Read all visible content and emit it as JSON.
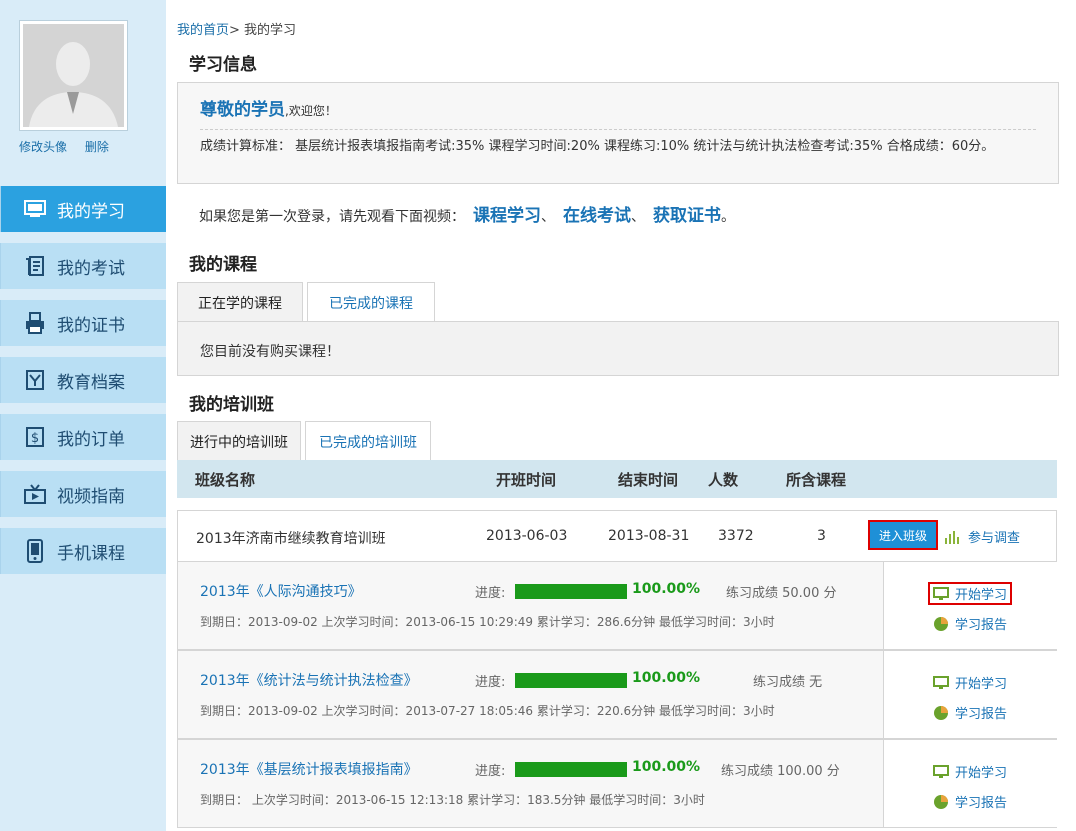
{
  "sidebar": {
    "change_avatar": "修改头像",
    "delete": "删除",
    "items": [
      {
        "label": "我的学习",
        "icon": "monitor-icon"
      },
      {
        "label": "我的考试",
        "icon": "exam-paper-icon"
      },
      {
        "label": "我的证书",
        "icon": "printer-icon"
      },
      {
        "label": "教育档案",
        "icon": "archive-icon"
      },
      {
        "label": "我的订单",
        "icon": "order-icon"
      },
      {
        "label": "视频指南",
        "icon": "tv-icon"
      },
      {
        "label": "手机课程",
        "icon": "phone-icon"
      }
    ]
  },
  "breadcrumb": {
    "home": "我的首页",
    "sep": ">",
    "current": " 我的学习"
  },
  "study_info": {
    "title": "学习信息",
    "greeting": "尊敬的学员",
    "welcome": ",欢迎您！",
    "criteria": "成绩计算标准：  基层统计报表填报指南考试:35%  课程学习时间:20%  课程练习:10%  统计法与统计执法检查考试:35%  合格成绩：60分。"
  },
  "first_login": {
    "text": "如果您是第一次登录，请先观看下面视频：",
    "links": [
      "课程学习",
      "在线考试",
      "获取证书"
    ],
    "seps": [
      "、",
      "、",
      "。"
    ]
  },
  "my_courses": {
    "title": "我的课程",
    "tabs": [
      "正在学的课程",
      "已完成的课程"
    ],
    "empty": "您目前没有购买课程！"
  },
  "training": {
    "title": "我的培训班",
    "tabs": [
      "进行中的培训班",
      "已完成的培训班"
    ],
    "headers": [
      "班级名称",
      "开班时间",
      "结束时间",
      "人数",
      "所含课程"
    ],
    "class": {
      "name": "2013年济南市继续教育培训班",
      "start": "2013-06-03",
      "end": "2013-08-31",
      "count": "3372",
      "courses": "3",
      "enter_btn": "进入班级",
      "survey": "参与调查"
    },
    "course_rows": [
      {
        "title": "2013年《人际沟通技巧》",
        "progress_label": "进度:",
        "progress": 1.0,
        "progress_text": "100.00%",
        "score": "练习成绩 50.00 分",
        "meta": "到期日：2013-09-02    上次学习时间：2013-06-15 10:29:49    累计学习：286.6分钟  最低学习时间：3小时",
        "start": "开始学习",
        "report": "学习报告"
      },
      {
        "title": "2013年《统计法与统计执法检查》",
        "progress_label": "进度:",
        "progress": 1.0,
        "progress_text": "100.00%",
        "score": "练习成绩 无",
        "meta": "到期日：2013-09-02    上次学习时间：2013-07-27 18:05:46    累计学习：220.6分钟  最低学习时间：3小时",
        "start": "开始学习",
        "report": "学习报告"
      },
      {
        "title": "2013年《基层统计报表填报指南》",
        "progress_label": "进度:",
        "progress": 1.0,
        "progress_text": "100.00%",
        "score": "练习成绩 100.00 分",
        "meta": "到期日：      上次学习时间：2013-06-15 12:13:18    累计学习：183.5分钟  最低学习时间：3小时",
        "start": "开始学习",
        "report": "学习报告"
      }
    ]
  },
  "colors": {
    "accent": "#2ba1e0",
    "link": "#1a73b5",
    "progress": "#1a9a1a",
    "highlight": "#dd0000"
  }
}
